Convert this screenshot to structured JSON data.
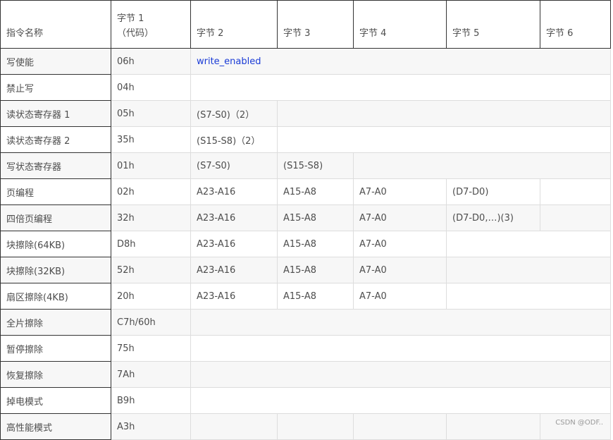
{
  "table": {
    "headers": [
      "指令名称",
      "字节 1\n（代码）",
      "字节 2",
      "字节 3",
      "字节 4",
      "字节 5",
      "字节 6"
    ],
    "header_byte1_line1": "字节 1",
    "header_byte1_line2": "（代码）",
    "rows": [
      {
        "name": "写使能",
        "code": "06h",
        "b2": "write_enabled",
        "b3": "",
        "b4": "",
        "b5": "",
        "b6": ""
      },
      {
        "name": "禁止写",
        "code": "04h",
        "b2": "",
        "b3": "",
        "b4": "",
        "b5": "",
        "b6": ""
      },
      {
        "name": "读状态寄存器 1",
        "code": "05h",
        "b2": "(S7-S0)（2）",
        "b3": "",
        "b4": "",
        "b5": "",
        "b6": ""
      },
      {
        "name": "读状态寄存器 2",
        "code": "35h",
        "b2": "(S15-S8)（2）",
        "b3": "",
        "b4": "",
        "b5": "",
        "b6": ""
      },
      {
        "name": "写状态寄存器",
        "code": "01h",
        "b2": "(S7-S0)",
        "b3": "(S15-S8)",
        "b4": "",
        "b5": "",
        "b6": ""
      },
      {
        "name": "页编程",
        "code": "02h",
        "b2": "A23-A16",
        "b3": "A15-A8",
        "b4": "A7-A0",
        "b5": "(D7-D0)",
        "b6": ""
      },
      {
        "name": "四倍页编程",
        "code": "32h",
        "b2": "A23-A16",
        "b3": "A15-A8",
        "b4": "A7-A0",
        "b5": "(D7-D0,…)(3)",
        "b6": ""
      },
      {
        "name": "块擦除(64KB)",
        "code": "D8h",
        "b2": "A23-A16",
        "b3": "A15-A8",
        "b4": "A7-A0",
        "b5": "",
        "b6": ""
      },
      {
        "name": "块擦除(32KB)",
        "code": "52h",
        "b2": "A23-A16",
        "b3": "A15-A8",
        "b4": "A7-A0",
        "b5": "",
        "b6": ""
      },
      {
        "name": "扇区擦除(4KB)",
        "code": "20h",
        "b2": "A23-A16",
        "b3": "A15-A8",
        "b4": "A7-A0",
        "b5": "",
        "b6": ""
      },
      {
        "name": "全片擦除",
        "code": "C7h/60h",
        "b2": "",
        "b3": "",
        "b4": "",
        "b5": "",
        "b6": ""
      },
      {
        "name": "暂停擦除",
        "code": "75h",
        "b2": "",
        "b3": "",
        "b4": "",
        "b5": "",
        "b6": ""
      },
      {
        "name": "恢复擦除",
        "code": "7Ah",
        "b2": "",
        "b3": "",
        "b4": "",
        "b5": "",
        "b6": ""
      },
      {
        "name": "掉电模式",
        "code": "B9h",
        "b2": "",
        "b3": "",
        "b4": "",
        "b5": "",
        "b6": ""
      },
      {
        "name": "高性能模式",
        "code": "A3h",
        "b2": "",
        "b3": "",
        "b4": "",
        "b5": "",
        "b6": ""
      }
    ]
  },
  "watermark": "CSDN @ODF..",
  "colors": {
    "link": "#1a3bd6",
    "stripe": "#f7f7f7",
    "text": "#4d4d4d"
  }
}
